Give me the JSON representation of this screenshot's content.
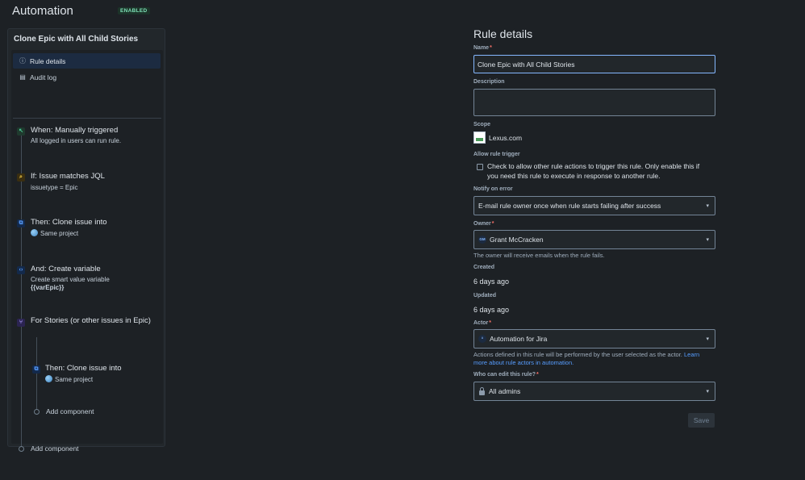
{
  "header": {
    "title": "Automation",
    "status_badge": "ENABLED"
  },
  "rule_panel": {
    "title": "Clone Epic with All Child Stories",
    "nav": [
      {
        "label": "Rule details",
        "icon": "info-icon",
        "active": true
      },
      {
        "label": "Audit log",
        "icon": "document-icon",
        "active": false
      }
    ],
    "components": [
      {
        "title": "When: Manually triggered",
        "sub": "All logged in users can run rule.",
        "icon": "trigger-icon",
        "color": "#4bce97"
      },
      {
        "title": "If: Issue matches JQL",
        "sub": "issuetype = Epic",
        "icon": "search-icon",
        "color": "#f5cd47"
      },
      {
        "title": "Then: Clone issue into",
        "sub": "Same project",
        "icon": "clone-icon",
        "color": "#579dff"
      },
      {
        "title": "And: Create variable",
        "sub": "Create smart value variable",
        "sub2": "{{varEpic}}",
        "icon": "variable-icon",
        "color": "#579dff"
      },
      {
        "title": "For Stories (or other issues in Epic)",
        "icon": "branch-icon",
        "color": "#9f8fef"
      }
    ],
    "nested": {
      "title": "Then: Clone issue into",
      "sub": "Same project",
      "icon": "clone-icon"
    },
    "add_component_inner": "Add component",
    "add_component_outer": "Add component"
  },
  "form": {
    "title": "Rule details",
    "name_label": "Name",
    "name_value": "Clone Epic with All Child Stories",
    "description_label": "Description",
    "scope_label": "Scope",
    "scope_value": "Lexus.com",
    "allow_trigger_label": "Allow rule trigger",
    "allow_trigger_text_1": "Check to allow other rule actions to trigger this rule. Only enable this if",
    "allow_trigger_text_2": "you need this rule to execute in response to another rule.",
    "allow_trigger_checked": false,
    "notify_label": "Notify on error",
    "notify_value": "E-mail rule owner once when rule starts failing after success",
    "owner_label": "Owner",
    "owner_initials": "GM",
    "owner_value": "Grant McCracken",
    "owner_help": "The owner will receive emails when the rule fails.",
    "created_label": "Created",
    "created_value": "6 days ago",
    "updated_label": "Updated",
    "updated_value": "6 days ago",
    "actor_label": "Actor",
    "actor_value": "Automation for Jira",
    "actor_help_1": "Actions defined in this rule will be performed by the user selected as the actor.",
    "actor_help_link_1": "Learn",
    "actor_help_link_2": "more about rule actors in automation.",
    "editors_label": "Who can edit this rule?",
    "editors_value": "All admins",
    "save_label": "Save"
  }
}
